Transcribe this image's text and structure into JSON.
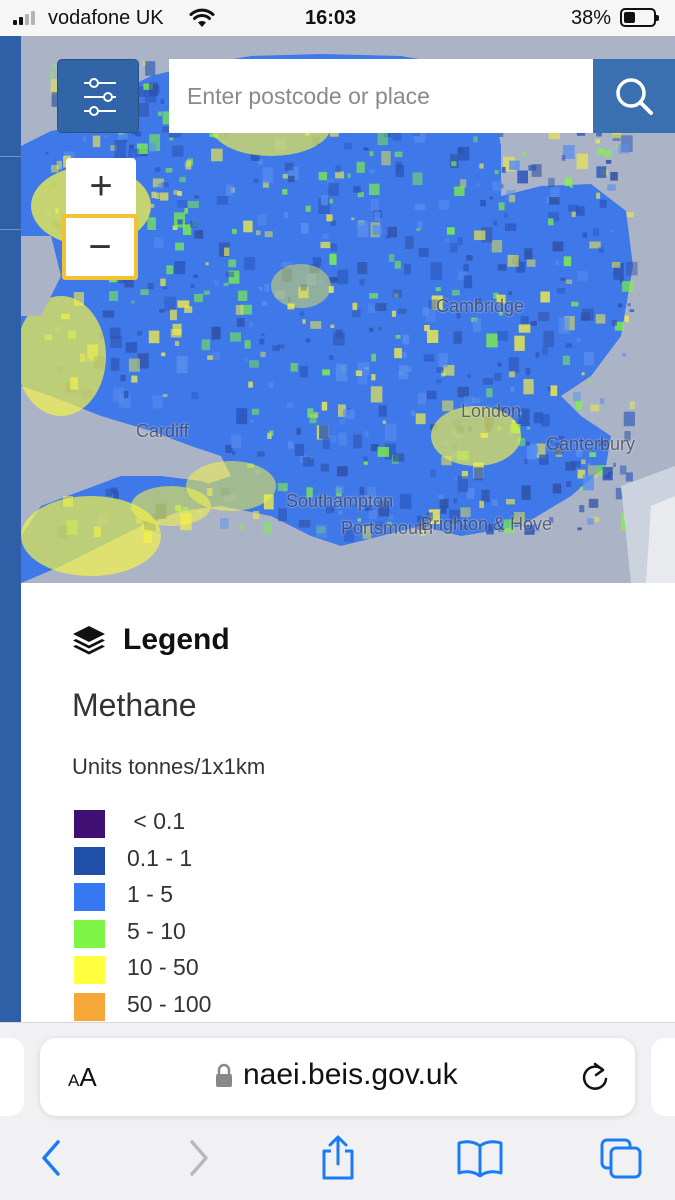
{
  "status_bar": {
    "carrier": "vodafone UK",
    "time": "16:03",
    "battery_percent": "38%",
    "battery_level": 0.38,
    "signal_bars_active": 2,
    "signal_bars_total": 4
  },
  "map": {
    "search": {
      "placeholder": "Enter postcode or place"
    },
    "zoom_in_symbol": "+",
    "zoom_out_symbol": "−",
    "place_labels": [
      "Cardiff",
      "Southampton",
      "Portsmouth",
      "Brighton & Hove",
      "Cambridge",
      "London",
      "Canterbury"
    ]
  },
  "legend": {
    "title": "Legend",
    "layer_name": "Methane",
    "units": "Units tonnes/1x1km",
    "items": [
      {
        "label": " < 0.1",
        "color": "#3f0f73"
      },
      {
        "label": "0.1 - 1",
        "color": "#1f4fa6"
      },
      {
        "label": "1 - 5",
        "color": "#3578f2"
      },
      {
        "label": "5 - 10",
        "color": "#7ef545"
      },
      {
        "label": "10 - 50",
        "color": "#ffff40"
      },
      {
        "label": "50 - 100",
        "color": "#f5a838"
      }
    ]
  },
  "browser": {
    "text_size_small": "A",
    "text_size_large": "A",
    "url": "naei.beis.gov.uk"
  },
  "colors": {
    "accent_blue": "#3264a8",
    "map_sea": "#aab4c6",
    "focus_outline": "#f1c232",
    "ios_blue": "#1a7cf5"
  },
  "icons": {
    "filter": "sliders-icon",
    "search": "magnifier-icon",
    "legend": "layers-icon",
    "back": "chevron-left-icon",
    "forward": "chevron-right-icon",
    "share": "share-icon",
    "bookmarks": "book-icon",
    "tabs": "tabs-icon"
  }
}
